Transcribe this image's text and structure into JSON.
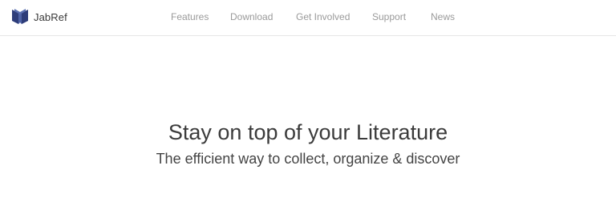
{
  "brand": {
    "name": "JabRef",
    "logo_colors": [
      "#2e3d7a",
      "#5a6fb0"
    ]
  },
  "nav": {
    "items": [
      {
        "label": "Features"
      },
      {
        "label": "Download"
      },
      {
        "label": "Get Involved"
      },
      {
        "label": "Support"
      },
      {
        "label": "News"
      }
    ]
  },
  "hero": {
    "title": "Stay on top of your Literature",
    "subtitle": "The efficient way to collect, organize & discover"
  }
}
